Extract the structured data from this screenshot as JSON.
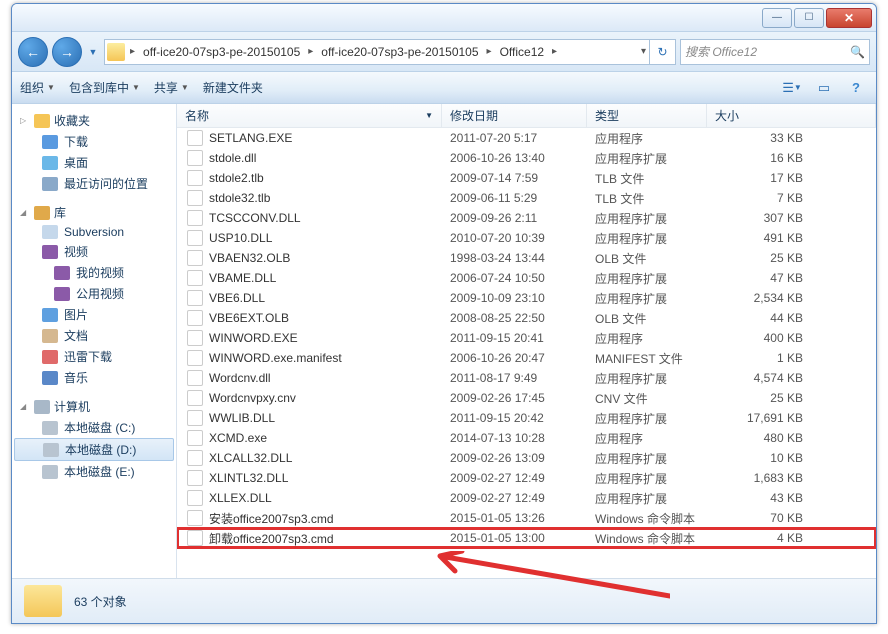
{
  "titlebar": {
    "min": "—",
    "max": "☐",
    "close": "✕"
  },
  "nav": {
    "back": "←",
    "fwd": "→",
    "dropdown": "▼",
    "crumbs": [
      "off-ice20-07sp3-pe-20150105",
      "off-ice20-07sp3-pe-20150105",
      "Office12"
    ],
    "search_placeholder": "搜索 Office12"
  },
  "toolbar": {
    "organize": "组织",
    "include": "包含到库中",
    "share": "共享",
    "newfolder": "新建文件夹"
  },
  "sidebar": {
    "favorites": "收藏夹",
    "fav_items": [
      {
        "label": "下载",
        "icon": "ic-dl"
      },
      {
        "label": "桌面",
        "icon": "ic-desk"
      },
      {
        "label": "最近访问的位置",
        "icon": "ic-rec"
      }
    ],
    "libraries": "库",
    "lib_items": [
      {
        "label": "Subversion",
        "icon": "ic-svn"
      },
      {
        "label": "视频",
        "icon": "ic-vid"
      },
      {
        "label": "我的视频",
        "icon": "ic-vid",
        "sub": true
      },
      {
        "label": "公用视频",
        "icon": "ic-vid",
        "sub": true
      },
      {
        "label": "图片",
        "icon": "ic-pic"
      },
      {
        "label": "文档",
        "icon": "ic-doc"
      },
      {
        "label": "迅雷下载",
        "icon": "ic-thd"
      },
      {
        "label": "音乐",
        "icon": "ic-mus"
      }
    ],
    "computer": "计算机",
    "drives": [
      "本地磁盘 (C:)",
      "本地磁盘 (D:)",
      "本地磁盘 (E:)"
    ],
    "selected_drive": 1
  },
  "columns": {
    "name": "名称",
    "date": "修改日期",
    "type": "类型",
    "size": "大小"
  },
  "files": [
    {
      "name": "SETLANG.EXE",
      "date": "2011-07-20 5:17",
      "type": "应用程序",
      "size": "33 KB",
      "icon": "ic-exe"
    },
    {
      "name": "stdole.dll",
      "date": "2006-10-26 13:40",
      "type": "应用程序扩展",
      "size": "16 KB",
      "icon": "ic-dll"
    },
    {
      "name": "stdole2.tlb",
      "date": "2009-07-14 7:59",
      "type": "TLB 文件",
      "size": "17 KB",
      "icon": "ic-tlb"
    },
    {
      "name": "stdole32.tlb",
      "date": "2009-06-11 5:29",
      "type": "TLB 文件",
      "size": "7 KB",
      "icon": "ic-tlb"
    },
    {
      "name": "TCSCCONV.DLL",
      "date": "2009-09-26 2:11",
      "type": "应用程序扩展",
      "size": "307 KB",
      "icon": "ic-dll"
    },
    {
      "name": "USP10.DLL",
      "date": "2010-07-20 10:39",
      "type": "应用程序扩展",
      "size": "491 KB",
      "icon": "ic-dll"
    },
    {
      "name": "VBAEN32.OLB",
      "date": "1998-03-24 13:44",
      "type": "OLB 文件",
      "size": "25 KB",
      "icon": "ic-tlb"
    },
    {
      "name": "VBAME.DLL",
      "date": "2006-07-24 10:50",
      "type": "应用程序扩展",
      "size": "47 KB",
      "icon": "ic-dll"
    },
    {
      "name": "VBE6.DLL",
      "date": "2009-10-09 23:10",
      "type": "应用程序扩展",
      "size": "2,534 KB",
      "icon": "ic-dll"
    },
    {
      "name": "VBE6EXT.OLB",
      "date": "2008-08-25 22:50",
      "type": "OLB 文件",
      "size": "44 KB",
      "icon": "ic-tlb"
    },
    {
      "name": "WINWORD.EXE",
      "date": "2011-09-15 20:41",
      "type": "应用程序",
      "size": "400 KB",
      "icon": "ic-exe"
    },
    {
      "name": "WINWORD.exe.manifest",
      "date": "2006-10-26 20:47",
      "type": "MANIFEST 文件",
      "size": "1 KB",
      "icon": "ic-tlb"
    },
    {
      "name": "Wordcnv.dll",
      "date": "2011-08-17 9:49",
      "type": "应用程序扩展",
      "size": "4,574 KB",
      "icon": "ic-dll"
    },
    {
      "name": "Wordcnvpxy.cnv",
      "date": "2009-02-26 17:45",
      "type": "CNV 文件",
      "size": "25 KB",
      "icon": "ic-tlb"
    },
    {
      "name": "WWLIB.DLL",
      "date": "2011-09-15 20:42",
      "type": "应用程序扩展",
      "size": "17,691 KB",
      "icon": "ic-dll"
    },
    {
      "name": "XCMD.exe",
      "date": "2014-07-13 10:28",
      "type": "应用程序",
      "size": "480 KB",
      "icon": "ic-exe"
    },
    {
      "name": "XLCALL32.DLL",
      "date": "2009-02-26 13:09",
      "type": "应用程序扩展",
      "size": "10 KB",
      "icon": "ic-dll"
    },
    {
      "name": "XLINTL32.DLL",
      "date": "2009-02-27 12:49",
      "type": "应用程序扩展",
      "size": "1,683 KB",
      "icon": "ic-dll"
    },
    {
      "name": "XLLEX.DLL",
      "date": "2009-02-27 12:49",
      "type": "应用程序扩展",
      "size": "43 KB",
      "icon": "ic-dll"
    },
    {
      "name": "安装office2007sp3.cmd",
      "date": "2015-01-05 13:26",
      "type": "Windows 命令脚本",
      "size": "70 KB",
      "icon": "ic-cmd"
    },
    {
      "name": "卸载office2007sp3.cmd",
      "date": "2015-01-05 13:00",
      "type": "Windows 命令脚本",
      "size": "4 KB",
      "icon": "ic-cmd",
      "highlight": true
    }
  ],
  "status": {
    "count": "63 个对象"
  }
}
